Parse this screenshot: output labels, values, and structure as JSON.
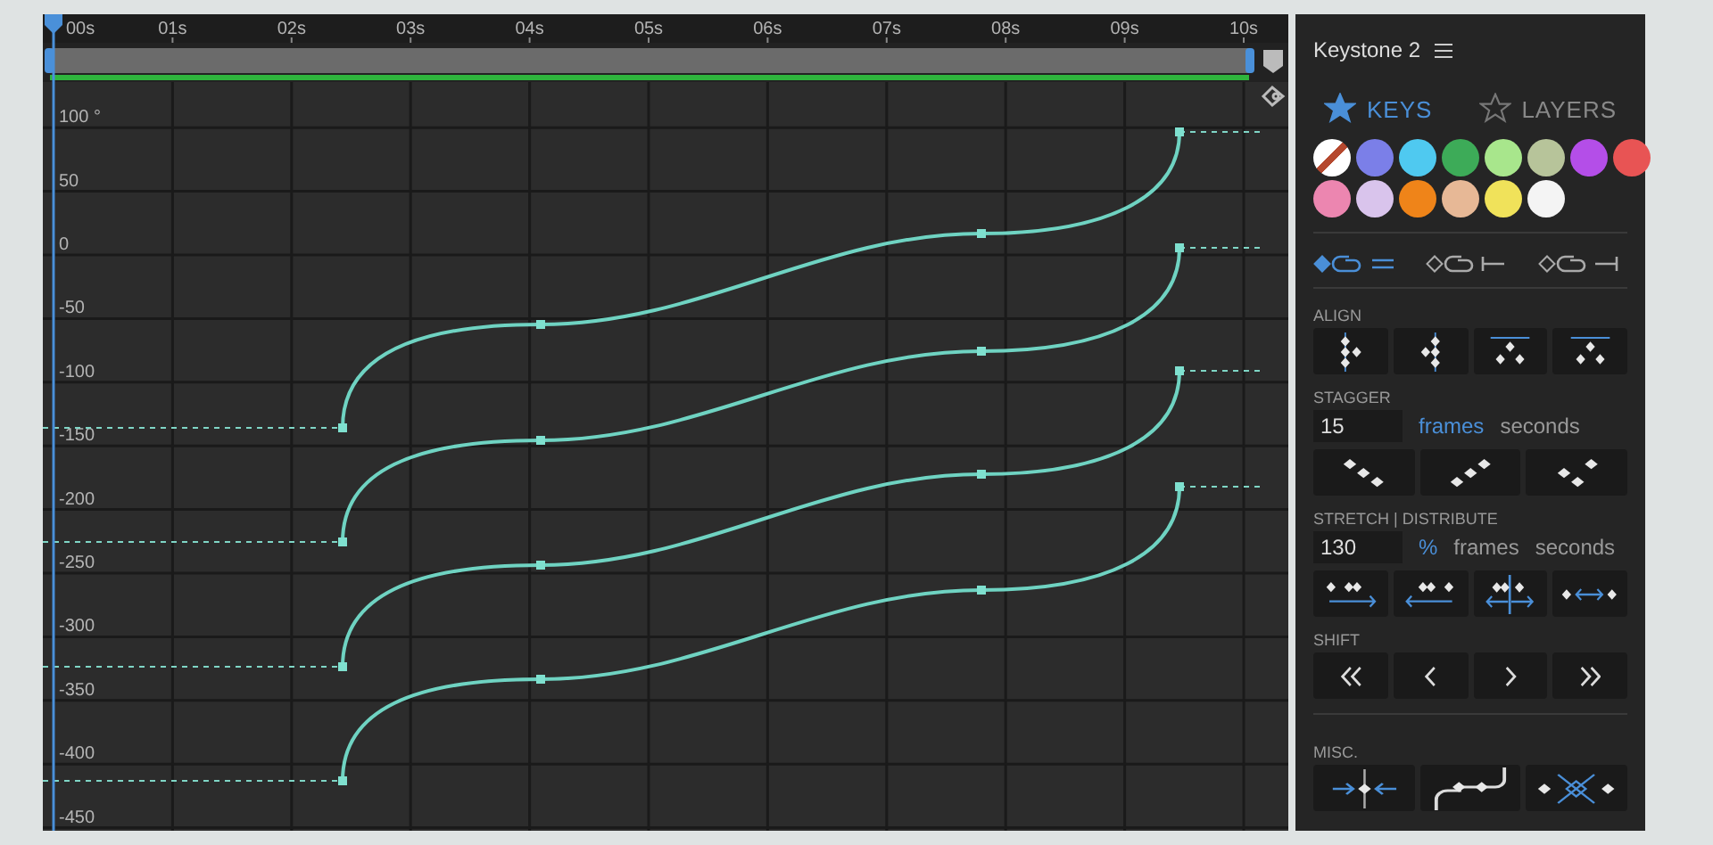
{
  "graph_editor": {
    "ruler_labels": [
      "00s",
      "01s",
      "02s",
      "03s",
      "04s",
      "05s",
      "06s",
      "07s",
      "08s",
      "09s",
      "10s"
    ],
    "value_labels": [
      "100 °",
      "50",
      "0",
      "-50",
      "-100",
      "-150",
      "-200",
      "-250",
      "-300",
      "-350",
      "-400",
      "-450"
    ]
  },
  "panel": {
    "title": "Keystone 2",
    "tabs": [
      {
        "label": "KEYS",
        "selected": true
      },
      {
        "label": "LAYERS",
        "selected": false
      }
    ],
    "swatches": [
      {
        "kind": "none"
      },
      {
        "kind": "color",
        "color": "#7b7fe8"
      },
      {
        "kind": "color",
        "color": "#4fc9f0"
      },
      {
        "kind": "color",
        "color": "#3dab58"
      },
      {
        "kind": "color",
        "color": "#a8e68c"
      },
      {
        "kind": "color",
        "color": "#b7c49a"
      },
      {
        "kind": "color",
        "color": "#b44ee8"
      },
      {
        "kind": "color",
        "color": "#e85454"
      },
      {
        "kind": "color",
        "color": "#ec86b0"
      },
      {
        "kind": "color",
        "color": "#d9c4ec"
      },
      {
        "kind": "color",
        "color": "#ef8419"
      },
      {
        "kind": "color",
        "color": "#e7b896"
      },
      {
        "kind": "color",
        "color": "#f0e25a"
      },
      {
        "kind": "color",
        "color": "#f4f4f4"
      }
    ],
    "key_modes": [
      {
        "selected": true
      },
      {
        "selected": false
      },
      {
        "selected": false
      }
    ],
    "sections": [
      {
        "kind": "align",
        "label": "ALIGN"
      },
      {
        "kind": "stagger",
        "label": "STAGGER",
        "value": "15",
        "units": [
          {
            "label": "frames",
            "selected": true
          },
          {
            "label": "seconds",
            "selected": false
          }
        ]
      },
      {
        "kind": "stretch",
        "label": "STRETCH | DISTRIBUTE",
        "value": "130",
        "units": [
          {
            "label": "%",
            "selected": true
          },
          {
            "label": "frames",
            "selected": false
          },
          {
            "label": "seconds",
            "selected": false
          }
        ]
      },
      {
        "kind": "shift",
        "label": "SHIFT"
      },
      {
        "kind": "misc",
        "label": "MISC."
      }
    ]
  }
}
